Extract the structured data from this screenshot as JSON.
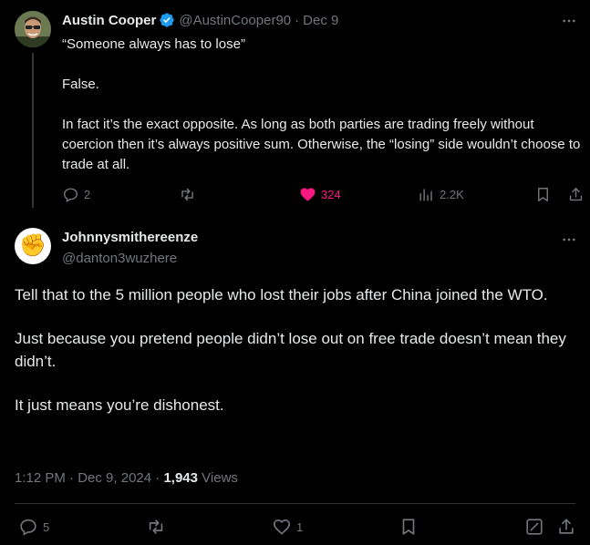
{
  "parent_tweet": {
    "author_name": "Austin Cooper",
    "handle": "@AustinCooper90",
    "separator": "·",
    "date": "Dec 9",
    "paragraphs": [
      "“Someone always has to lose”",
      "False.",
      "In fact it’s the exact opposite. As long as both parties are trading freely without coercion then it’s always positive sum. Otherwise, the “losing” side wouldn’t choose to trade at all."
    ],
    "replies": "2",
    "likes": "324",
    "views": "2.2K",
    "liked": true,
    "verified": true
  },
  "focal_tweet": {
    "author_name": "Johnnysmithereenze",
    "handle": "@danton3wuzhere",
    "avatar_emoji": "✊",
    "paragraphs": [
      "Tell that to the 5 million people who lost their jobs after China joined the WTO.",
      "Just because you pretend people didn’t lose out on free trade doesn’t mean they didn’t.",
      "It just means you’re dishonest."
    ],
    "time": "1:12 PM",
    "date": "Dec 9, 2024",
    "separator": "·",
    "views_count": "1,943",
    "views_label": "Views",
    "replies": "5",
    "likes": "1"
  },
  "colors": {
    "background": "#000000",
    "text": "#e7e9ea",
    "muted": "#71767b",
    "like_active": "#f91880",
    "verified": "#1d9bf0"
  }
}
